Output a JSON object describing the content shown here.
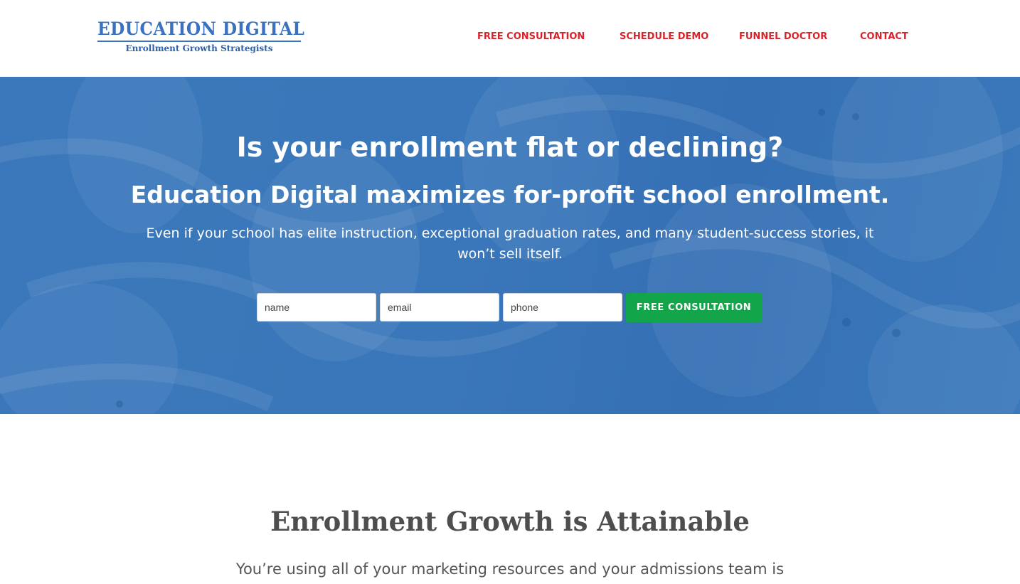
{
  "header": {
    "logo_title": "EDUCATION DIGITAL",
    "logo_tagline": "Enrollment Growth Strategists",
    "nav": [
      {
        "label": "FREE CONSULTATION"
      },
      {
        "label": "SCHEDULE DEMO"
      },
      {
        "label": "FUNNEL DOCTOR"
      },
      {
        "label": "CONTACT"
      }
    ]
  },
  "hero": {
    "title": "Is your enrollment flat or declining?",
    "subtitle": "Education Digital maximizes for-profit school enrollment.",
    "text": "Even if your school has elite instruction, exceptional graduation rates, and many student-success stories, it won’t sell itself.",
    "form": {
      "name_placeholder": "name",
      "email_placeholder": "email",
      "phone_placeholder": "phone",
      "submit_label": "FREE CONSULTATION"
    }
  },
  "section": {
    "title": "Enrollment Growth is Attainable",
    "text": "You’re using all of your marketing resources and your admissions team is"
  },
  "colors": {
    "brand_blue": "#3a72c0",
    "nav_red": "#d8232a",
    "hero_blue": "#3a77ba",
    "cta_green": "#12a54a"
  }
}
